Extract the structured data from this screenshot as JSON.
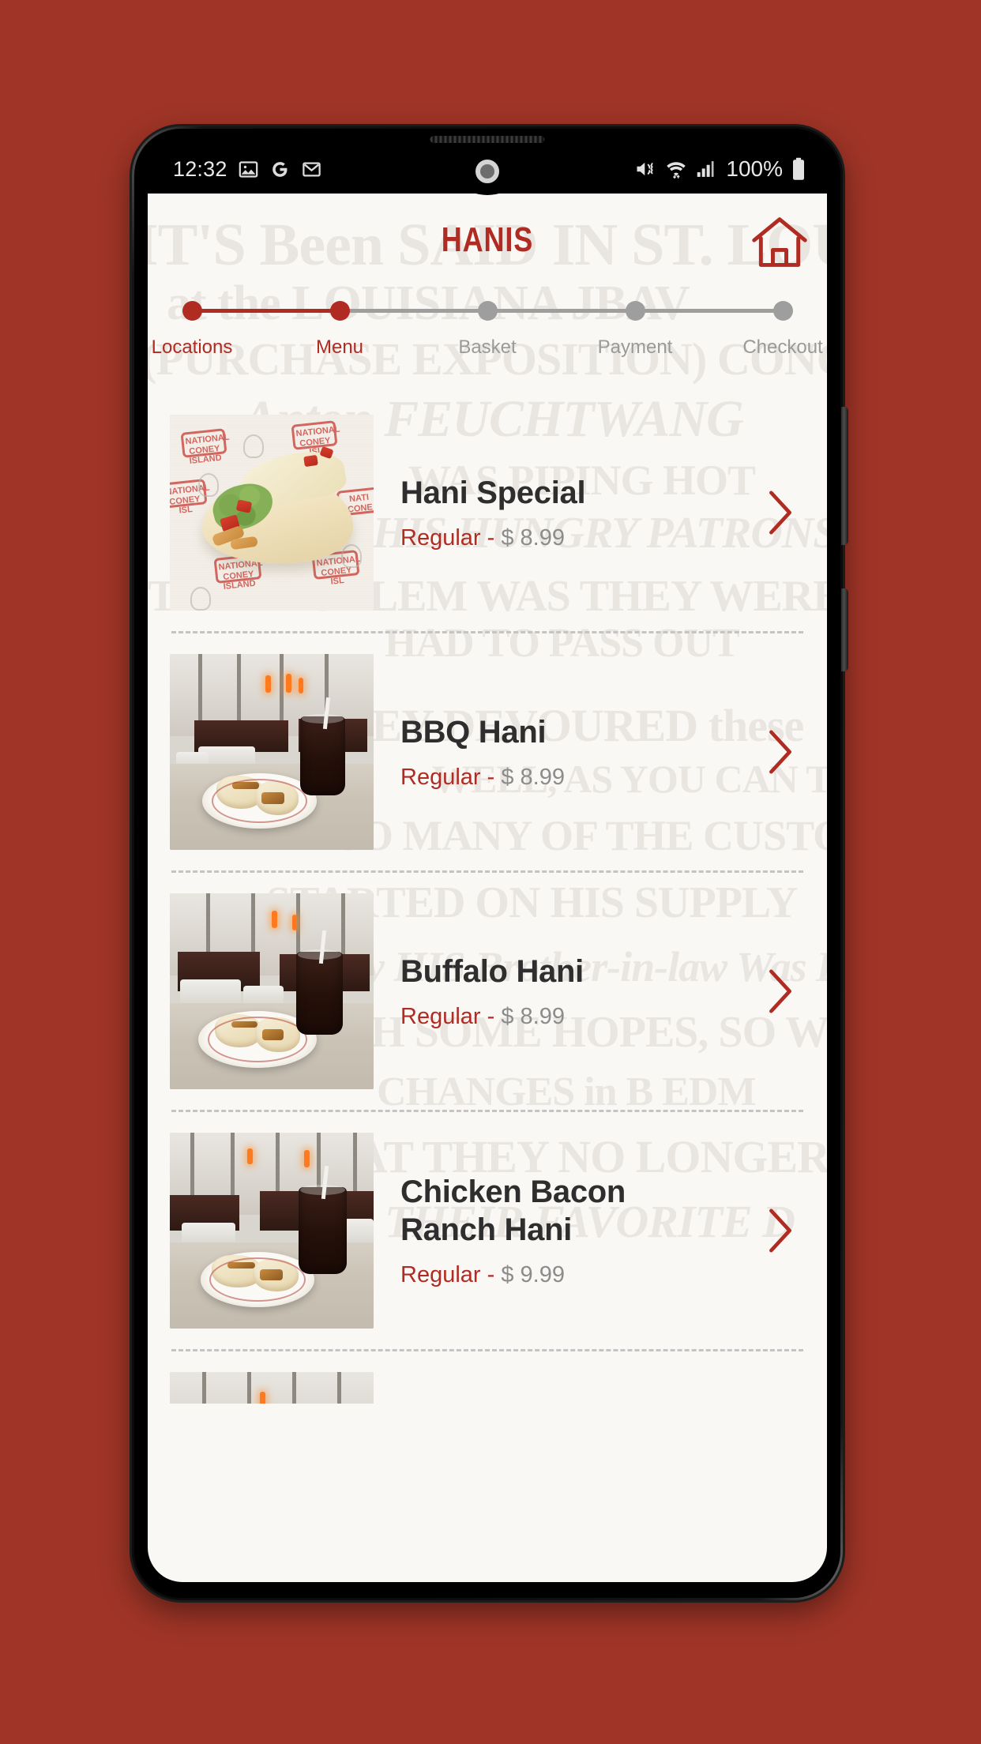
{
  "theme": {
    "page_background": "#a03527",
    "brand_red": "#b02b22",
    "app_background": "#faf8f5",
    "title_text": "#2e2e2e",
    "muted_text": "#8c8c8c",
    "inactive_step": "#9e9e9e"
  },
  "status_bar": {
    "clock": "12:32",
    "left_icons": [
      "photos-icon",
      "google-icon",
      "gmail-icon"
    ],
    "right_icons": [
      "mute-icon",
      "wifi-icon",
      "signal-icon"
    ],
    "battery_percent": "100%",
    "battery_icon": "battery-full-icon"
  },
  "header": {
    "title": "HANIS",
    "home_icon": "home-icon"
  },
  "stepper": {
    "steps": [
      {
        "label": "Locations",
        "active": true
      },
      {
        "label": "Menu",
        "active": true
      },
      {
        "label": "Basket",
        "active": false
      },
      {
        "label": "Payment",
        "active": false
      },
      {
        "label": "Checkout",
        "active": false
      }
    ]
  },
  "menu": {
    "items": [
      {
        "name": "Hani Special",
        "size": "Regular",
        "separator": "-",
        "price": "$ 8.99",
        "photo": "pita-wrap-on-deli-paper",
        "chevron": "chevron-right-icon"
      },
      {
        "name": "BBQ Hani",
        "size": "Regular",
        "separator": "-",
        "price": "$ 8.99",
        "photo": "pita-on-plate-with-soda-restaurant",
        "chevron": "chevron-right-icon"
      },
      {
        "name": "Buffalo Hani",
        "size": "Regular",
        "separator": "-",
        "price": "$ 8.99",
        "photo": "pita-on-plate-with-soda-restaurant",
        "chevron": "chevron-right-icon"
      },
      {
        "name": "Chicken Bacon Ranch Hani",
        "size": "Regular",
        "separator": "-",
        "price": "$ 9.99",
        "photo": "pita-on-plate-with-soda-restaurant",
        "chevron": "chevron-right-icon"
      }
    ]
  },
  "background_watermark": {
    "lines": [
      "IT'S Been SAID IN ST. LOUIS",
      "at the LOUISIANA    JBAV",
      "(PURCHASE EXPOSITION)  CONCE",
      "Anton FEUCHTWANG",
      "WAS PIPING HOT",
      "TO HIS HUNGRY PATRONS    HO",
      "THE PROBLEM WAS THEY WERE TOO",
      "HAD TO PASS OUT",
      "aS THEY DEVOURED these",
      "WELL, AS YOU CAN TH",
      "SO MANY OF THE CUSTOMER",
      "STARTED ON HIS SUPPLY",
      "Ironically HIS Brother-in-law Was B",
      "WITH SOME HOPES, SO WHI",
      "CHANGES in    B EDM",
      "THAT THEY NO LONGER    TO",
      "THEIR FAVORITE D"
    ]
  }
}
